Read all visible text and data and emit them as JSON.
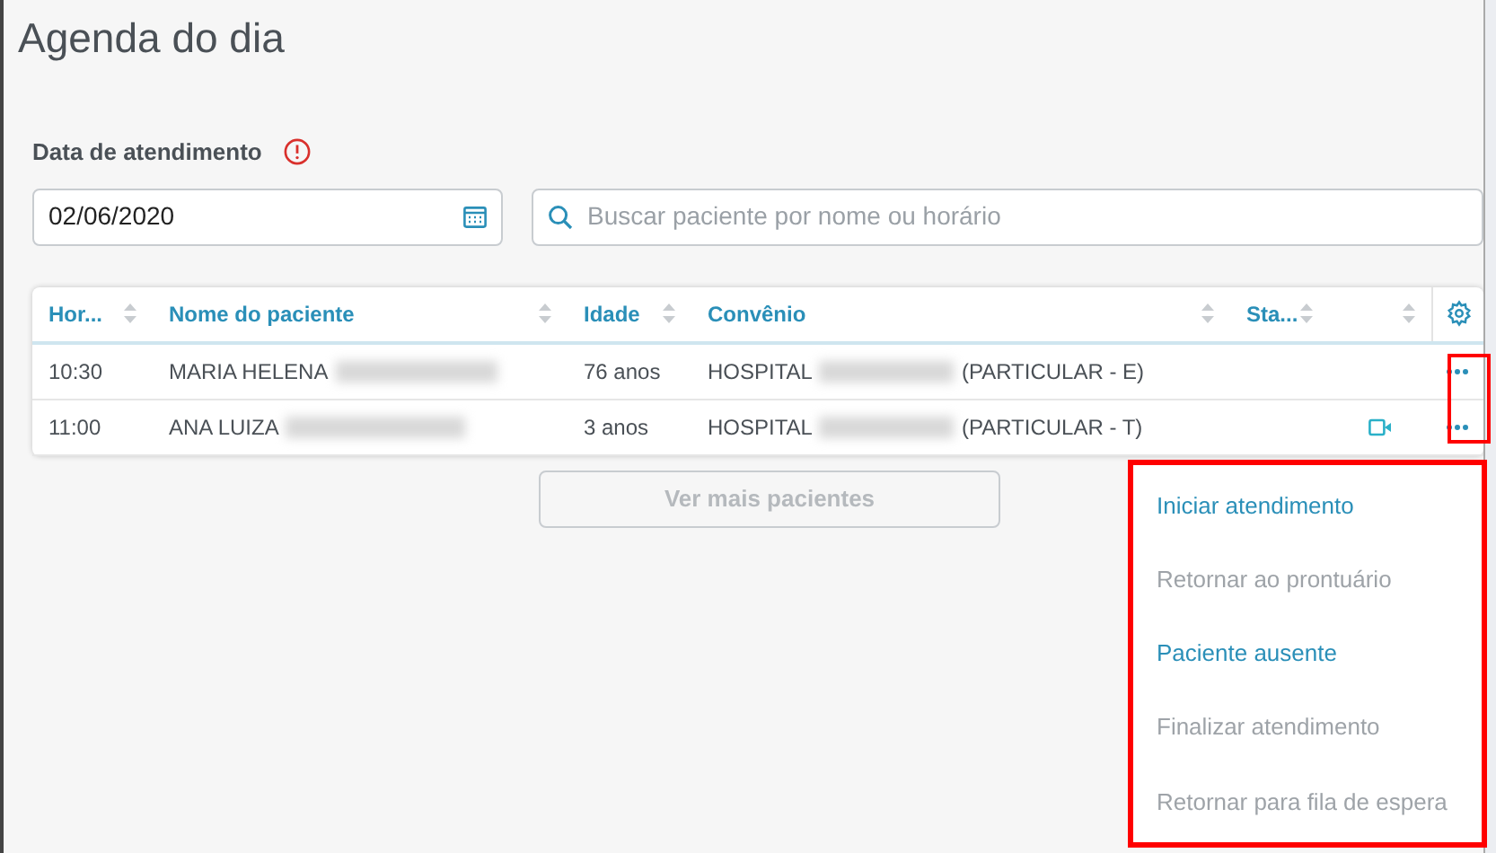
{
  "title": "Agenda do dia",
  "date_label": "Data de atendimento",
  "date_field": {
    "value": "02/06/2020"
  },
  "search": {
    "placeholder": "Buscar paciente por nome ou horário"
  },
  "table": {
    "columns": [
      "Hor...",
      "Nome do paciente",
      "Idade",
      "Convênio",
      "Sta..."
    ],
    "rows": [
      {
        "time": "10:30",
        "name": "MARIA HELENA",
        "age": "76 anos",
        "insurer": "HOSPITAL",
        "plan": "(PARTICULAR - E)",
        "video": false
      },
      {
        "time": "11:00",
        "name": "ANA LUIZA",
        "age": "3 anos",
        "insurer": "HOSPITAL",
        "plan": "(PARTICULAR - T)",
        "video": true
      }
    ]
  },
  "more_button": "Ver mais pacientes",
  "menu": [
    {
      "label": "Iniciar atendimento",
      "disabled": false
    },
    {
      "label": "Retornar ao prontuário",
      "disabled": true
    },
    {
      "label": "Paciente ausente",
      "disabled": false
    },
    {
      "label": "Finalizar atendimento",
      "disabled": true
    },
    {
      "label": "Retornar para fila de espera",
      "disabled": true
    }
  ]
}
